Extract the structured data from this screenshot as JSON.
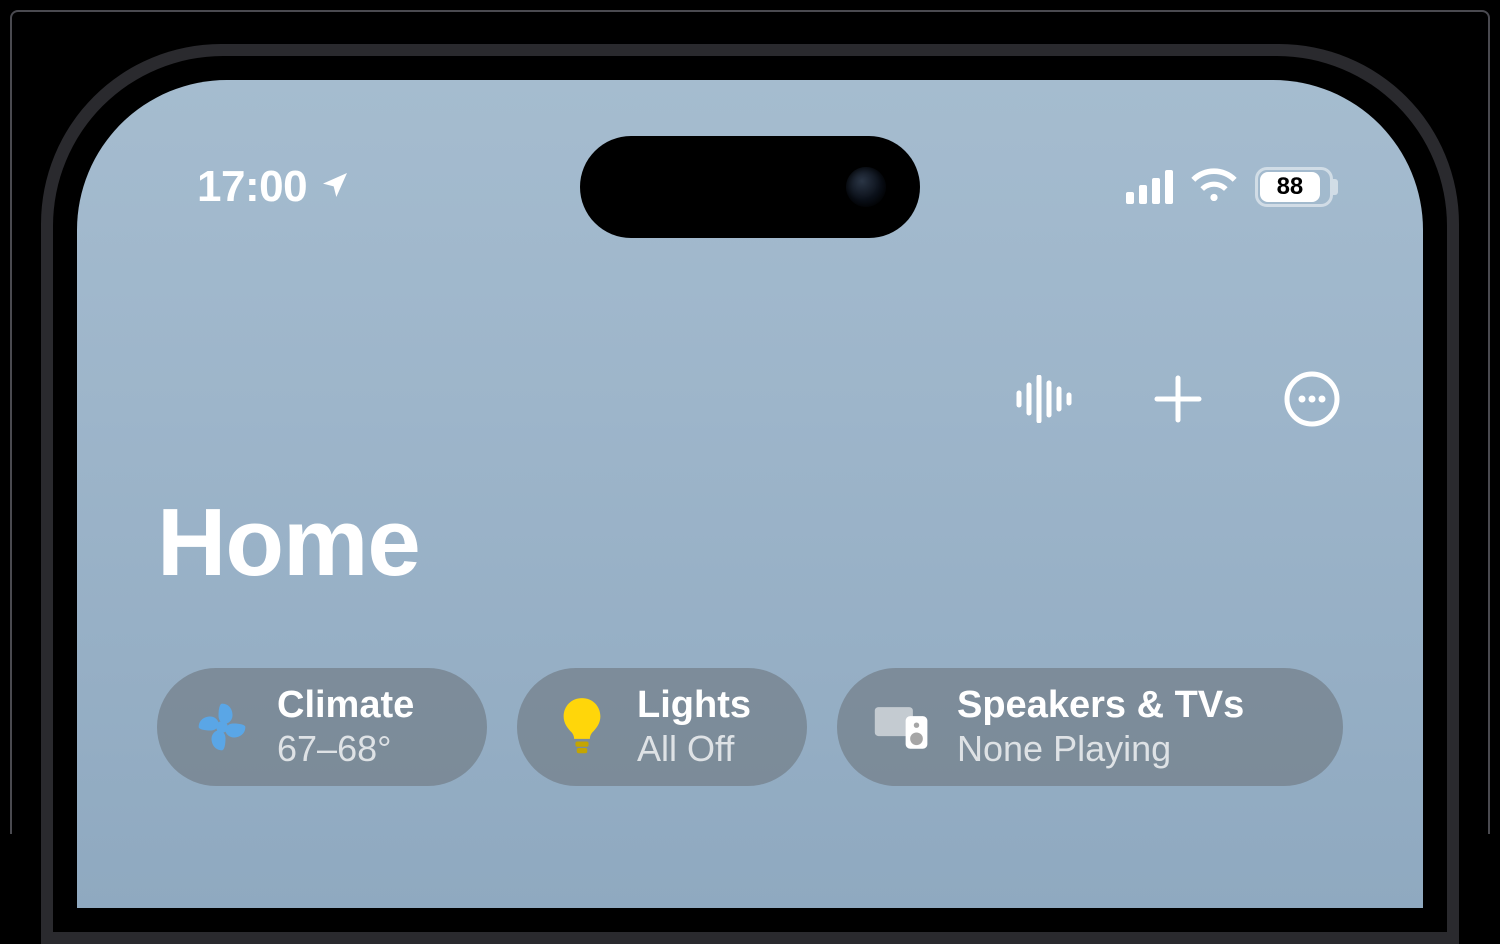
{
  "status_bar": {
    "time": "17:00",
    "battery_percent": "88"
  },
  "page": {
    "title": "Home"
  },
  "cards": {
    "climate": {
      "title": "Climate",
      "detail": "67–68°"
    },
    "lights": {
      "title": "Lights",
      "detail": "All Off"
    },
    "speakers": {
      "title": "Speakers & TVs",
      "detail": "None Playing"
    }
  }
}
